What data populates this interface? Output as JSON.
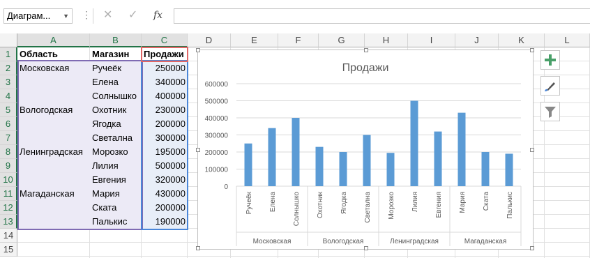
{
  "formula_bar": {
    "name_box": "Диаграм...",
    "cancel_icon": "✕",
    "enter_icon": "✓",
    "fx_label": "fx",
    "formula": ""
  },
  "columns": [
    "A",
    "B",
    "C",
    "D",
    "E",
    "F",
    "G",
    "H",
    "I",
    "J",
    "K",
    "L"
  ],
  "rows": [
    "1",
    "2",
    "3",
    "4",
    "5",
    "6",
    "7",
    "8",
    "9",
    "10",
    "11",
    "12",
    "13",
    "14",
    "15"
  ],
  "table": {
    "headers": [
      "Область",
      "Магазин",
      "Продажи"
    ],
    "rows": [
      [
        "Московская",
        "Ручеёк",
        "250000"
      ],
      [
        "",
        "Елена",
        "340000"
      ],
      [
        "",
        "Солнышко",
        "400000"
      ],
      [
        "Вологодская",
        "Охотник",
        "230000"
      ],
      [
        "",
        "Ягодка",
        "200000"
      ],
      [
        "",
        "Светална",
        "300000"
      ],
      [
        "Ленинградская",
        "Морозко",
        "195000"
      ],
      [
        "",
        "Лилия",
        "500000"
      ],
      [
        "",
        "Евгения",
        "320000"
      ],
      [
        "Магаданская",
        "Мария",
        "430000"
      ],
      [
        "",
        "Ската",
        "200000"
      ],
      [
        "",
        "Палькис",
        "190000"
      ]
    ]
  },
  "chart_data": {
    "type": "bar",
    "title": "Продажи",
    "categories": [
      "Ручеёк",
      "Елена",
      "Солнышко",
      "Охотник",
      "Ягодка",
      "Светална",
      "Морозко",
      "Лилия",
      "Евгения",
      "Мария",
      "Ската",
      "Палькис"
    ],
    "groups": [
      {
        "name": "Московская",
        "count": 3
      },
      {
        "name": "Вологодская",
        "count": 3
      },
      {
        "name": "Ленинградская",
        "count": 3
      },
      {
        "name": "Магаданская",
        "count": 3
      }
    ],
    "values": [
      250000,
      340000,
      400000,
      230000,
      200000,
      300000,
      195000,
      500000,
      320000,
      430000,
      200000,
      190000
    ],
    "ylim": [
      0,
      600000
    ],
    "yticks": [
      "0",
      "100000",
      "200000",
      "300000",
      "400000",
      "500000",
      "600000"
    ],
    "bar_color": "#5b9bd5",
    "grid": true,
    "legend": "none"
  },
  "side_buttons": [
    {
      "name": "chart-elements-button",
      "icon": "plus-icon"
    },
    {
      "name": "chart-styles-button",
      "icon": "brush-icon"
    },
    {
      "name": "chart-filters-button",
      "icon": "filter-icon"
    }
  ],
  "colors": {
    "accent": "#217346",
    "selection_purple": "#7f6bb3",
    "selection_red": "#e06666",
    "selection_blue": "#4a86d8"
  }
}
